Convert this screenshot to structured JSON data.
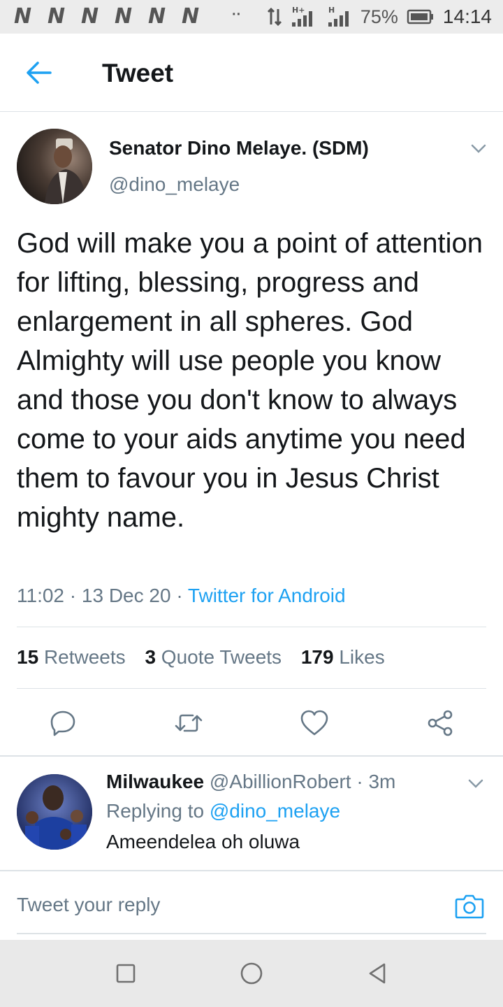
{
  "status_bar": {
    "notification_icons": [
      "N",
      "N",
      "N",
      "N",
      "N",
      "N"
    ],
    "more_dots": "··",
    "network_label": "H+",
    "battery_percent": "75%",
    "time": "14:14"
  },
  "app_bar": {
    "title": "Tweet",
    "back_icon": "arrow-left-icon"
  },
  "tweet": {
    "author_name": "Senator Dino Melaye. (SDM)",
    "author_handle": "@dino_melaye",
    "text": "God will make you a point of attention for lifting, blessing, progress and enlargement in all spheres. God Almighty will use people you know and those you don't know to always come to your aids anytime you need them to favour you in Jesus Christ mighty name.",
    "time": "11:02",
    "date": "13 Dec 20",
    "source": "Twitter for Android",
    "stats": {
      "retweets_count": "15",
      "retweets_label": "Retweets",
      "quotes_count": "3",
      "quotes_label": "Quote Tweets",
      "likes_count": "179",
      "likes_label": "Likes"
    }
  },
  "reply": {
    "author_name": "Milwaukee",
    "author_handle": "@AbillionRobert",
    "age": "3m",
    "replying_prefix": "Replying to",
    "replying_to": "@dino_melaye",
    "text": "Ameendelea oh oluwa"
  },
  "composer": {
    "placeholder": "Tweet your reply"
  },
  "colors": {
    "accent": "#1da1f2",
    "secondary_text": "#657786",
    "primary_text": "#14171a",
    "divider": "#dde2e6"
  }
}
